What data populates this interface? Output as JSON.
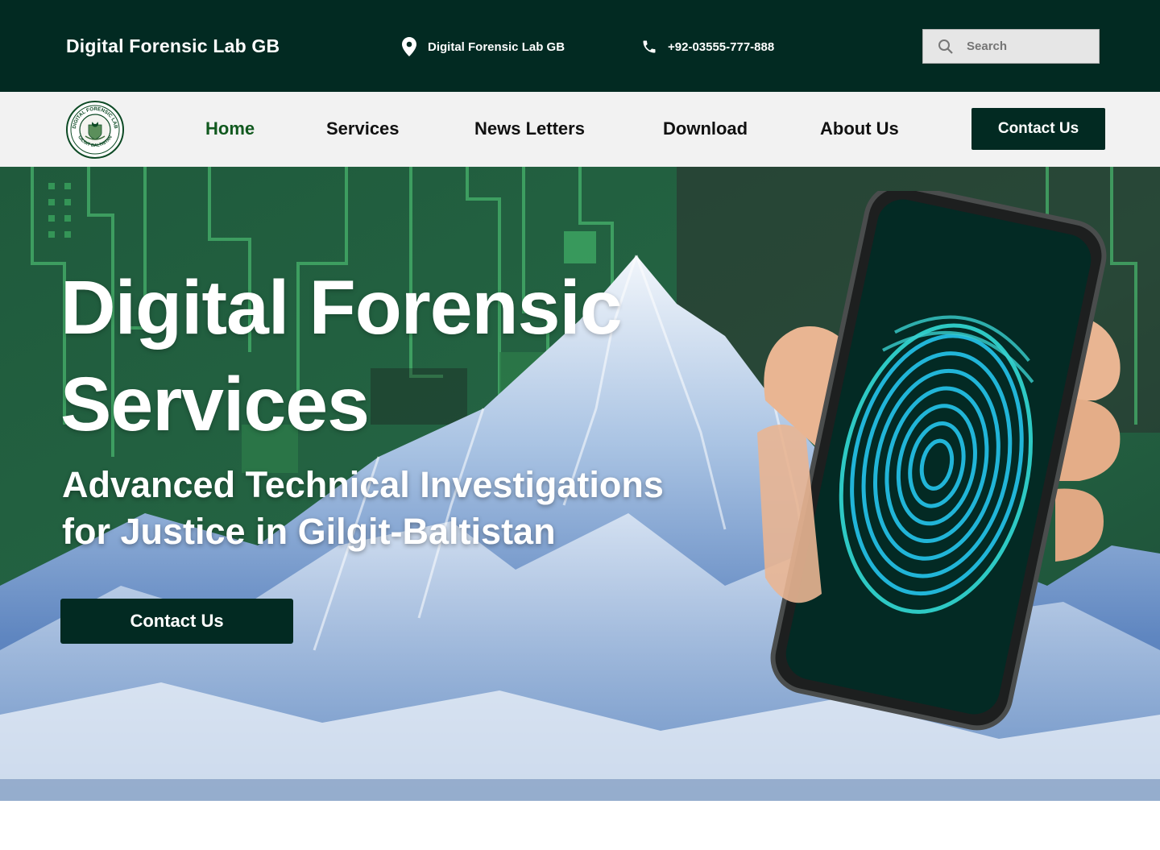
{
  "topbar": {
    "brand": "Digital Forensic Lab GB",
    "location_text": "Digital Forensic Lab GB",
    "location_icon": "map-pin-icon",
    "phone_text": "+92-03555-777-888",
    "phone_icon": "phone-icon",
    "search_placeholder": "Search",
    "search_icon": "search-icon",
    "background_color": "#022a22"
  },
  "nav": {
    "logo": "digital-forensic-lab-seal",
    "logo_text_top": "DIGITAL FORENSIC LAB",
    "logo_text_bottom": "GILGIT BALTISTAN",
    "items": [
      {
        "label": "Home",
        "active": true
      },
      {
        "label": "Services",
        "active": false
      },
      {
        "label": "News Letters",
        "active": false
      },
      {
        "label": "Download",
        "active": false
      },
      {
        "label": "About Us",
        "active": false
      }
    ],
    "cta_label": "Contact Us",
    "active_color": "#11591f"
  },
  "hero": {
    "title_line1": "Digital Forensic",
    "title_line2": "Services",
    "subtitle_line1": "Advanced Technical Investigations",
    "subtitle_line2": "for Justice in Gilgit-Baltistan",
    "cta_label": "Contact Us",
    "image": "phone-with-fingerprint-over-mountains-and-circuit-board"
  }
}
